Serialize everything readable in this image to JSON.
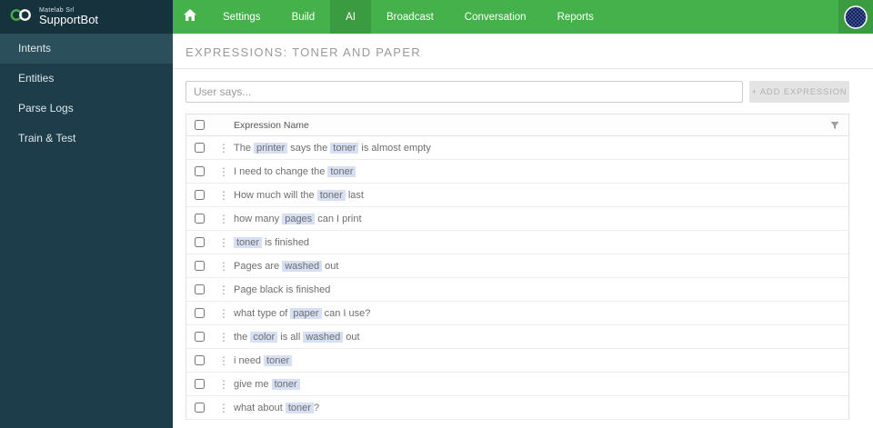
{
  "brand": {
    "company": "Matelab Srl",
    "product": "SupportBot"
  },
  "topnav": {
    "items": [
      {
        "label": "Settings"
      },
      {
        "label": "Build"
      },
      {
        "label": "AI"
      },
      {
        "label": "Broadcast"
      },
      {
        "label": "Conversation"
      },
      {
        "label": "Reports"
      }
    ]
  },
  "sidebar": {
    "items": [
      {
        "label": "Intents"
      },
      {
        "label": "Entities"
      },
      {
        "label": "Parse Logs"
      },
      {
        "label": "Train & Test"
      }
    ]
  },
  "page": {
    "title": "EXPRESSIONS: TONER AND PAPER"
  },
  "composer": {
    "placeholder": "User says...",
    "add_button_label": "+ ADD EXPRESSION"
  },
  "table": {
    "header": "Expression Name",
    "rows": [
      {
        "segments": [
          {
            "text": "The ",
            "highlight": false
          },
          {
            "text": "printer",
            "highlight": true
          },
          {
            "text": " says the ",
            "highlight": false
          },
          {
            "text": "toner",
            "highlight": true
          },
          {
            "text": " is almost empty",
            "highlight": false
          }
        ]
      },
      {
        "segments": [
          {
            "text": "I need to change the ",
            "highlight": false
          },
          {
            "text": "toner",
            "highlight": true
          }
        ]
      },
      {
        "segments": [
          {
            "text": "How much will the ",
            "highlight": false
          },
          {
            "text": "toner",
            "highlight": true
          },
          {
            "text": " last",
            "highlight": false
          }
        ]
      },
      {
        "segments": [
          {
            "text": "how many ",
            "highlight": false
          },
          {
            "text": "pages",
            "highlight": true
          },
          {
            "text": " can I print",
            "highlight": false
          }
        ]
      },
      {
        "segments": [
          {
            "text": "toner",
            "highlight": true
          },
          {
            "text": " is finished",
            "highlight": false
          }
        ]
      },
      {
        "segments": [
          {
            "text": "Pages are ",
            "highlight": false
          },
          {
            "text": "washed",
            "highlight": true
          },
          {
            "text": " out",
            "highlight": false
          }
        ]
      },
      {
        "segments": [
          {
            "text": "Page black is finished",
            "highlight": false
          }
        ]
      },
      {
        "segments": [
          {
            "text": "what type of ",
            "highlight": false
          },
          {
            "text": "paper",
            "highlight": true
          },
          {
            "text": " can I use?",
            "highlight": false
          }
        ]
      },
      {
        "segments": [
          {
            "text": "the ",
            "highlight": false
          },
          {
            "text": "color",
            "highlight": true
          },
          {
            "text": " is all ",
            "highlight": false
          },
          {
            "text": "washed",
            "highlight": true
          },
          {
            "text": " out",
            "highlight": false
          }
        ]
      },
      {
        "segments": [
          {
            "text": "i need ",
            "highlight": false
          },
          {
            "text": "toner",
            "highlight": true
          }
        ]
      },
      {
        "segments": [
          {
            "text": "give me ",
            "highlight": false
          },
          {
            "text": "toner",
            "highlight": true
          }
        ]
      },
      {
        "segments": [
          {
            "text": "what about ",
            "highlight": false
          },
          {
            "text": "toner",
            "highlight": true
          },
          {
            "text": "?",
            "highlight": false
          }
        ]
      }
    ]
  },
  "colors": {
    "topbar_green": "#45b14b",
    "topbar_green_active": "#3a9b41",
    "sidebar_dark": "#1d3d4a",
    "brand_dark": "#16323d",
    "entity_highlight": "#d7dff3"
  }
}
